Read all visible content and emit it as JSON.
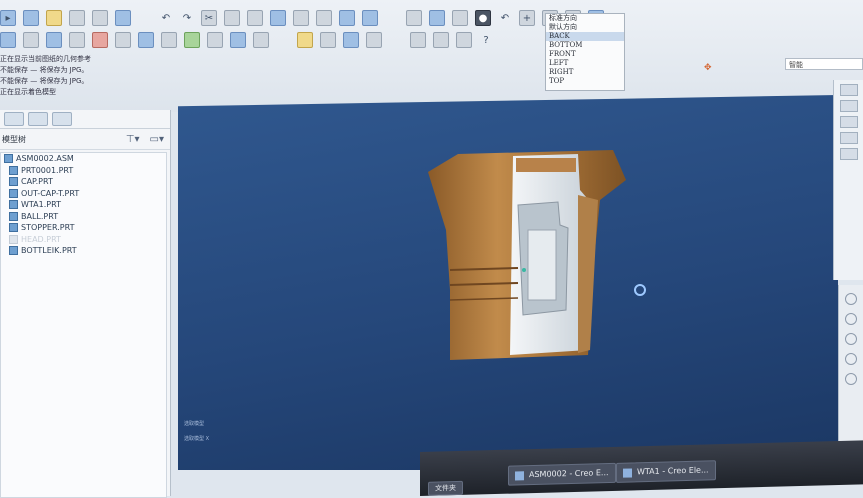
{
  "messages": [
    "正在显示当前图纸的几何参考",
    "不能保存 — 将保存为 JPG。",
    "不能保存 — 将保存为 JPG。",
    "正在显示着色模型"
  ],
  "view_list": [
    "标准方向",
    "默认方向",
    "BACK",
    "BOTTOM",
    "FRONT",
    "LEFT",
    "RIGHT",
    "TOP"
  ],
  "view_list_selected": "BACK",
  "right_field": "智能",
  "tree": {
    "header": "模型树",
    "root": "ASM0002.ASM",
    "children": [
      {
        "label": "PRT0001.PRT",
        "faded": false
      },
      {
        "label": "CAP.PRT",
        "faded": false
      },
      {
        "label": "OUT-CAP-T.PRT",
        "faded": false
      },
      {
        "label": "WTA1.PRT",
        "faded": false
      },
      {
        "label": "BALL.PRT",
        "faded": false
      },
      {
        "label": "STOPPER.PRT",
        "faded": false
      },
      {
        "label": "HEAD.PRT",
        "faded": true
      },
      {
        "label": "BOTTLEIK.PRT",
        "faded": false
      }
    ]
  },
  "viewport": {
    "coord_lines": [
      "选取模型",
      "选取模型  X"
    ]
  },
  "taskbar": {
    "tasks": [
      "ASM0002 - Creo E...",
      "WTA1 - Creo Ele...",
      "文件夹"
    ]
  },
  "colors": {
    "viewport_top": "#30588f",
    "viewport_bottom": "#1b3763",
    "model_copper": "#b07a3e",
    "model_section": "#e8eef2"
  }
}
